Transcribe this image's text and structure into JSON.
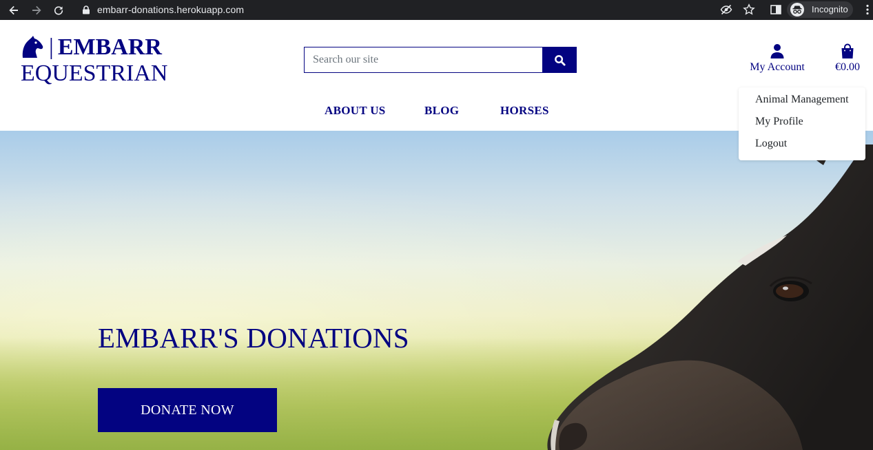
{
  "browser": {
    "url": "embarr-donations.herokuapp.com",
    "profile_label": "Incognito"
  },
  "brand": {
    "separator": "|",
    "line1": "EMBARR",
    "line2": "EQUESTRIAN",
    "color": "#030381"
  },
  "search": {
    "placeholder": "Search our site"
  },
  "account": {
    "label": "My Account"
  },
  "bag": {
    "total": "€0.00"
  },
  "nav": {
    "items": [
      "ABOUT US",
      "BLOG",
      "HORSES"
    ]
  },
  "account_menu": {
    "items": [
      "Animal Management",
      "My Profile",
      "Logout"
    ]
  },
  "hero": {
    "title": "EMBARR'S DONATIONS",
    "cta": "DONATE NOW"
  },
  "icons": {
    "logo": "horse-head-icon",
    "search": "search-icon",
    "account": "user-icon",
    "bag": "shopping-bag-icon"
  }
}
